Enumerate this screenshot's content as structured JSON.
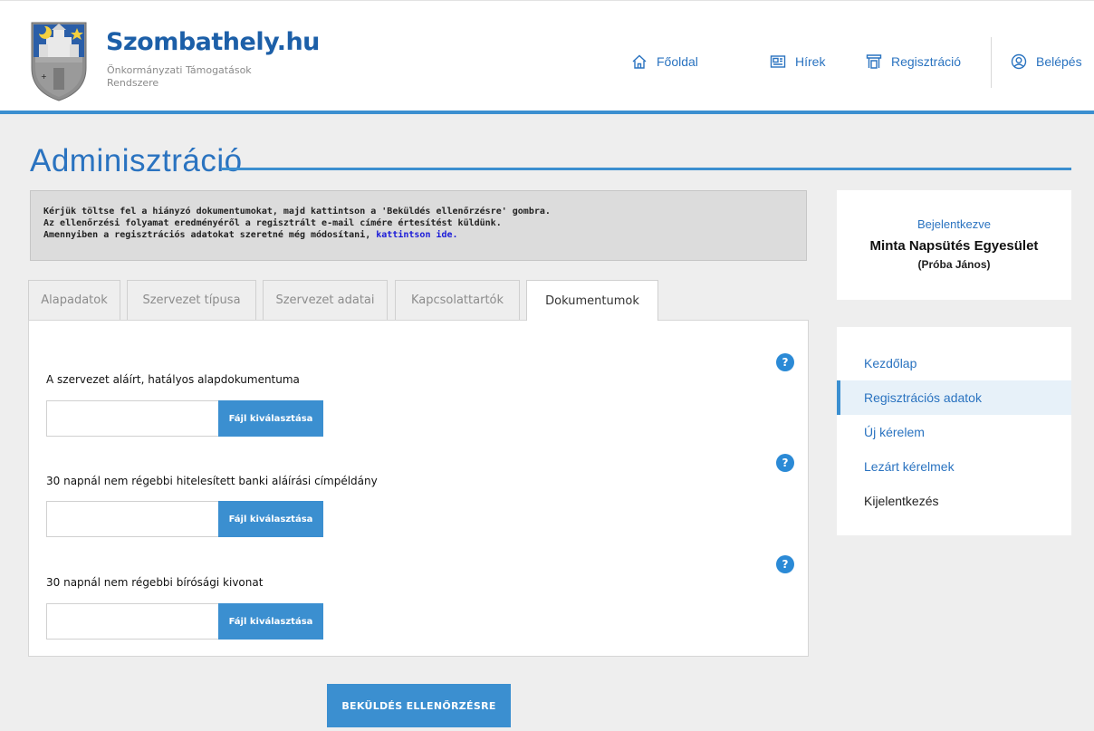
{
  "header": {
    "site_name": "Szombathely.hu",
    "site_sub": "Önkormányzati Támogatások Rendszere",
    "nav": [
      {
        "label": "Főoldal",
        "icon": "home-icon"
      },
      {
        "label": "Hírek",
        "icon": "news-icon"
      },
      {
        "label": "Regisztráció",
        "icon": "register-icon"
      },
      {
        "label": "Belépés",
        "icon": "user-icon"
      }
    ]
  },
  "page": {
    "title": "Adminisztráció"
  },
  "notice": {
    "line1": "Kérjük töltse fel a hiányzó dokumentumokat, majd kattintson a 'Beküldés ellenőrzésre' gombra.",
    "line2": "Az ellenőrzési folyamat eredményéről a regisztrált e-mail címére értesítést küldünk.",
    "line3": "Amennyiben a regisztrációs adatokat szeretné még módosítani, ",
    "link": "kattintson ide."
  },
  "tabs": [
    {
      "label": "Alapadatok",
      "active": false
    },
    {
      "label": "Szervezet típusa",
      "active": false
    },
    {
      "label": "Szervezet adatai",
      "active": false
    },
    {
      "label": "Kapcsolattartók",
      "active": false
    },
    {
      "label": "Dokumentumok",
      "active": true
    }
  ],
  "documents": [
    {
      "label": "A szervezet aláírt, hatályos alapdokumentuma",
      "button": "Fájl kiválasztása",
      "help": "?"
    },
    {
      "label": "30 napnál nem régebbi hitelesített banki aláírási címpéldány",
      "button": "Fájl kiválasztása",
      "help": "?"
    },
    {
      "label": "30 napnál nem régebbi bírósági kivonat",
      "button": "Fájl kiválasztása",
      "help": "?"
    }
  ],
  "submit_label": "BEKÜLDÉS ELLENŐRZÉSRE",
  "sidebar": {
    "status": "Bejelentkezve",
    "org": "Minta Napsütés Egyesület",
    "user": "(Próba János)",
    "menu": [
      {
        "label": "Kezdőlap"
      },
      {
        "label": "Regisztrációs adatok"
      },
      {
        "label": "Új kérelem"
      },
      {
        "label": "Lezárt kérelmek"
      },
      {
        "label": "Kijelentkezés"
      }
    ]
  },
  "colors": {
    "accent": "#3b8fd0",
    "link": "#2a73c0",
    "notice_bg": "#dcdcdc"
  }
}
